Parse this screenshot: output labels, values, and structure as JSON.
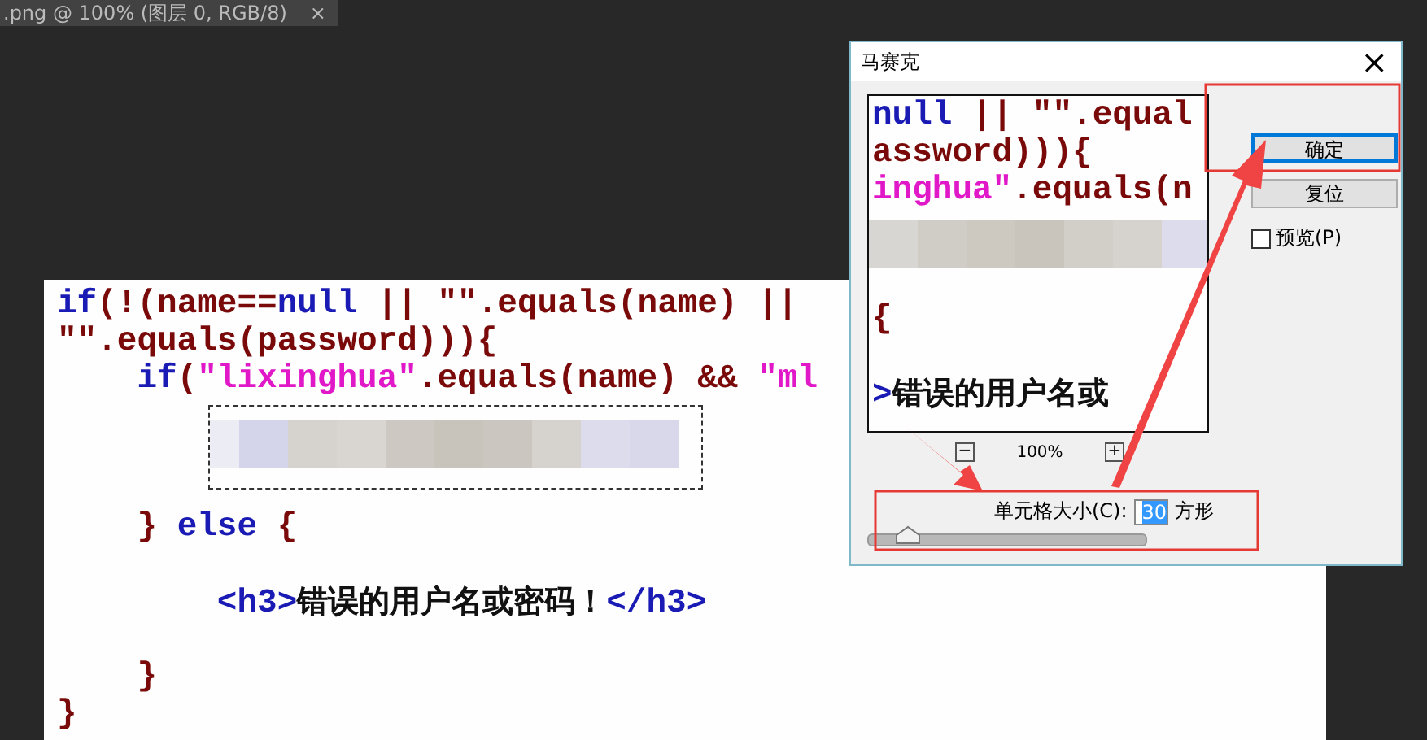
{
  "tab": {
    "title": ".png @ 100% (图层 0, RGB/8)",
    "close": "×"
  },
  "document": {
    "lines": [
      {
        "kind": "code",
        "tokens": [
          {
            "kind": "kw",
            "text": "if"
          },
          {
            "kind": "plain",
            "text": "(!(name=="
          },
          {
            "kind": "kw",
            "text": "null"
          },
          {
            "kind": "plain",
            "text": " || \"\".equals(name) ||"
          }
        ]
      },
      {
        "kind": "code",
        "tokens": [
          {
            "kind": "plain",
            "text": "\"\".equals(password))){"
          }
        ]
      },
      {
        "kind": "code",
        "tokens": [
          {
            "kind": "kw",
            "text": "    if"
          },
          {
            "kind": "plain",
            "text": "("
          },
          {
            "kind": "str",
            "text": "\"lixinghua\""
          },
          {
            "kind": "plain",
            "text": ".equals(name) && "
          },
          {
            "kind": "str",
            "text": "\"ml"
          }
        ]
      },
      {
        "kind": "mosaic"
      },
      {
        "kind": "code",
        "tokens": [
          {
            "kind": "plain",
            "text": "    } "
          },
          {
            "kind": "kw",
            "text": "else"
          },
          {
            "kind": "plain",
            "text": " {"
          }
        ]
      },
      {
        "kind": "blank"
      },
      {
        "kind": "code",
        "tokens": [
          {
            "kind": "tag",
            "text": "        <h3>"
          },
          {
            "kind": "text",
            "text": "错误的用户名或密码！"
          },
          {
            "kind": "tag",
            "text": "</h3>"
          }
        ]
      },
      {
        "kind": "blank"
      },
      {
        "kind": "code",
        "tokens": [
          {
            "kind": "plain",
            "text": "    }"
          }
        ]
      },
      {
        "kind": "code",
        "tokens": [
          {
            "kind": "plain",
            "text": "}"
          }
        ]
      }
    ]
  },
  "dialog": {
    "title": "马赛克",
    "close": "×",
    "preview_lines": [
      {
        "kind": "code",
        "tokens": [
          {
            "kind": "kw",
            "text": "null"
          },
          {
            "kind": "plain",
            "text": " || \"\".equal"
          }
        ]
      },
      {
        "kind": "code",
        "tokens": [
          {
            "kind": "plain",
            "text": "assword))){"
          }
        ]
      },
      {
        "kind": "code",
        "tokens": [
          {
            "kind": "str",
            "text": "inghua\""
          },
          {
            "kind": "plain",
            "text": ".equals(n"
          }
        ]
      },
      {
        "kind": "mosaic"
      },
      {
        "kind": "code",
        "tokens": [
          {
            "kind": "plain",
            "text": "{"
          }
        ]
      },
      {
        "kind": "blank"
      },
      {
        "kind": "code",
        "tokens": [
          {
            "kind": "tag",
            "text": ">"
          },
          {
            "kind": "text",
            "text": "错误的用户名或"
          }
        ]
      }
    ],
    "zoom_out": "−",
    "zoom": "100%",
    "zoom_in": "+",
    "buttons": [
      {
        "label": "确定",
        "selected": true
      },
      {
        "label": "复位",
        "selected": false
      }
    ],
    "preview_checkbox": {
      "label": "预览(P)",
      "checked": false
    },
    "cell_size": {
      "label": "单元格大小(C):",
      "value": "30",
      "unit": "方形",
      "level": 0.14
    }
  }
}
